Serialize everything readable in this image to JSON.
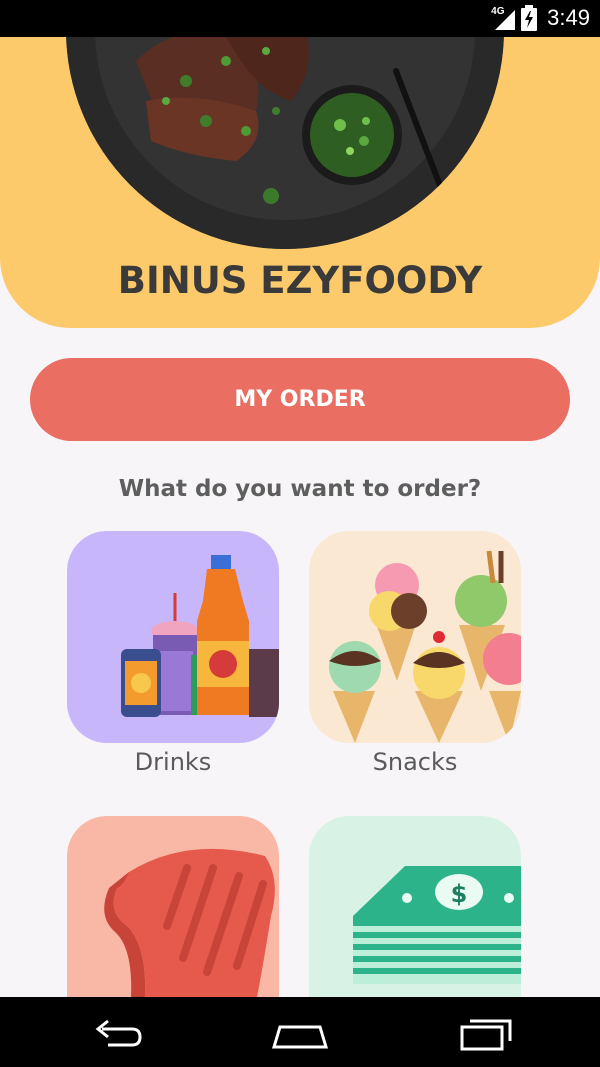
{
  "status_bar": {
    "network": "4G",
    "time": "3:49"
  },
  "header": {
    "title": "BINUS EZYFOODY"
  },
  "actions": {
    "my_order_label": "MY ORDER"
  },
  "prompt": "What do you want to order?",
  "categories": [
    {
      "label": "Drinks",
      "bg": "#c8b6fb"
    },
    {
      "label": "Snacks",
      "bg": "#fbe8d2"
    },
    {
      "label": "",
      "bg": "#f9b8a6"
    },
    {
      "label": "",
      "bg": "#d8f3e6"
    }
  ],
  "colors": {
    "header": "#fdca6b",
    "accent": "#ea6e61",
    "background": "#f7f5f8"
  }
}
